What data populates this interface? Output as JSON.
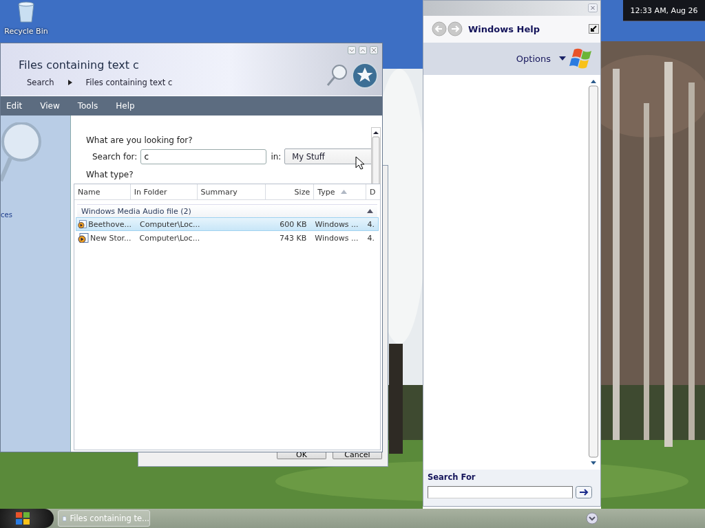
{
  "desktop": {
    "icons": [
      {
        "label": "Recycle Bin"
      }
    ],
    "clock": "12:33 AM, Aug 26"
  },
  "explorer": {
    "title": "Files containing text c",
    "breadcrumb": [
      "Search",
      "Files containing text c"
    ],
    "menu": [
      "Edit",
      "View",
      "Tools",
      "Help"
    ],
    "sidebar_text": "ces",
    "search": {
      "heading": "What are you looking for?",
      "label": "Search for:",
      "value": "c",
      "in_label": "in:",
      "location": "My Stuff",
      "type_heading": "What type?"
    },
    "columns": [
      {
        "label": "Name",
        "sorted": false
      },
      {
        "label": "In Folder",
        "sorted": false
      },
      {
        "label": "Summary",
        "sorted": false
      },
      {
        "label": "Size",
        "sorted": false
      },
      {
        "label": "Type",
        "sorted": true
      },
      {
        "label": "D",
        "sorted": false
      }
    ],
    "groups": [
      {
        "label": "Windows Media Audio file (2)",
        "expanded": true,
        "rows": [
          {
            "name": "Beethove...",
            "folder": "Computer\\Loc...",
            "size": "600 KB",
            "type": "Windows ...",
            "column_6": "4.",
            "selected": true
          },
          {
            "name": "New Stor...",
            "folder": "Computer\\Loc...",
            "size": "743 KB",
            "type": "Windows ...",
            "column_6": "4.",
            "selected": false
          }
        ]
      }
    ]
  },
  "dialog": {
    "buttons": [
      "OK",
      "Cancel"
    ]
  },
  "help": {
    "title": "Windows Help",
    "options": "Options",
    "search_label": "Search For"
  },
  "taskbar": {
    "buttons": [
      {
        "label": "Files containing te..."
      }
    ]
  }
}
